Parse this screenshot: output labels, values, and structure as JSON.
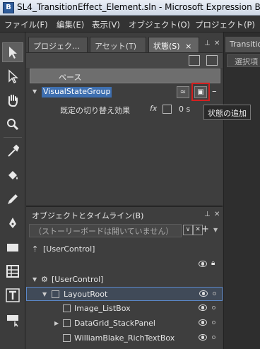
{
  "window": {
    "title": "SL4_TransitionEffect_Element.sln - Microsoft Expression Bl"
  },
  "menu": [
    "ファイル(F)",
    "編集(E)",
    "表示(V)",
    "オブジェクト(O)",
    "プロジェクト(P)"
  ],
  "tabs": {
    "projects": "プロジェク…",
    "assets": "アセット(T)",
    "states": "状態(S)",
    "states_close": "×"
  },
  "states": {
    "base": "ベース",
    "group": "VisualStateGroup",
    "transition_label": "既定の切り替え効果",
    "fx": "fx",
    "duration": "0 s",
    "tooltip": "状態の追加"
  },
  "right_panel": {
    "tab": "Transitio",
    "select": "選択項"
  },
  "objects": {
    "title": "オブジェクトとタイムライン(B)",
    "search": "（ストーリーボードは開いていません）",
    "tree": [
      {
        "label": "[UserControl]"
      },
      {
        "label": "[UserControl]"
      },
      {
        "label": "LayoutRoot"
      },
      {
        "label": "Image_ListBox"
      },
      {
        "label": "DataGrid_StackPanel"
      },
      {
        "label": "WilliamBlake_RichTextBox"
      }
    ]
  },
  "colors": {
    "accent": "#3e6fb0",
    "highlight": "#d42020"
  }
}
